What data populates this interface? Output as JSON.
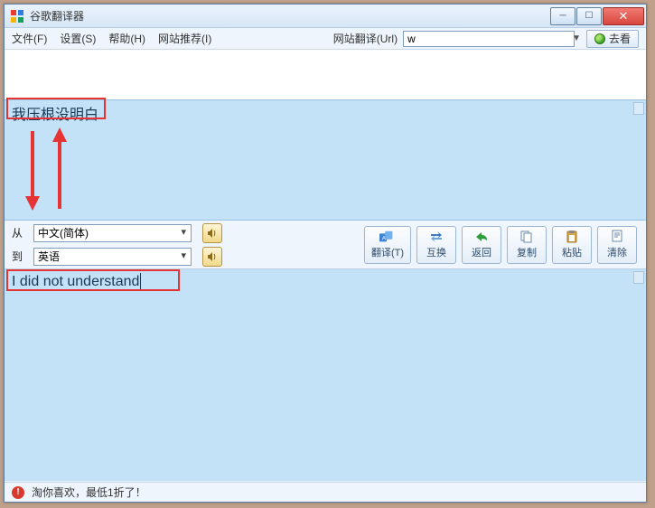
{
  "window": {
    "title": "谷歌翻译器",
    "icon_pixels": {
      "c1": "#eb3b2e",
      "c2": "#2f7de0",
      "c3": "#f4b400",
      "c4": "#18a061"
    }
  },
  "menu": {
    "file": "文件(F)",
    "settings": "设置(S)",
    "help": "帮助(H)",
    "recommend": "网站推荐(I)",
    "url_label": "网站翻译(Url)",
    "url_value": "w",
    "go_label": "去看"
  },
  "input_text": "我压根没明白",
  "lang": {
    "from_label": "从",
    "to_label": "到",
    "from_value": "中文(简体)",
    "to_value": "英语"
  },
  "actions": {
    "translate": "翻译(T)",
    "swap": "互换",
    "back": "返回",
    "copy": "复制",
    "paste": "粘贴",
    "clear": "清除"
  },
  "output_text": "I did not understand",
  "status_text": "淘你喜欢，最低1折了！",
  "colors": {
    "pane_bg": "#c3e2f8",
    "annotation": "#e63434"
  }
}
